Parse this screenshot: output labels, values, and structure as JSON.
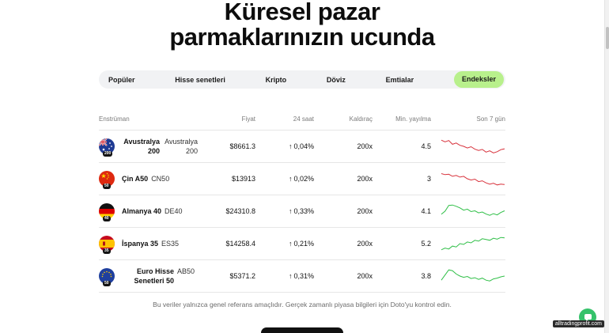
{
  "hero": {
    "line1": "Küresel pazar",
    "line2": "parmaklarınızın ucunda"
  },
  "tabs": [
    {
      "label": "Popüler",
      "active": false
    },
    {
      "label": "Hisse senetleri",
      "active": false
    },
    {
      "label": "Kripto",
      "active": false
    },
    {
      "label": "Döviz",
      "active": false
    },
    {
      "label": "Emtialar",
      "active": false
    },
    {
      "label": "Endeksler",
      "active": true
    }
  ],
  "table": {
    "headers": {
      "instrument": "Enstrüman",
      "price": "Fiyat",
      "change": "24 saat",
      "leverage": "Kaldıraç",
      "spread": "Min. yayılma",
      "chart": "Son 7 gün"
    },
    "rows": [
      {
        "name": "Avustralya 200",
        "ticker": "Avustralya 200",
        "badge": "200",
        "flag": "australia-flag-icon",
        "price": "$8661.3",
        "change": "0,04%",
        "leverage": "200x",
        "spread": "4.5",
        "trend": "down",
        "spark": [
          0.8,
          0.72,
          0.78,
          0.6,
          0.66,
          0.55,
          0.5,
          0.42,
          0.48,
          0.36,
          0.3,
          0.35,
          0.22,
          0.28,
          0.18,
          0.24,
          0.34,
          0.38
        ]
      },
      {
        "name": "Çin A50",
        "ticker": "CN50",
        "badge": "50",
        "flag": "china-flag-icon",
        "price": "$13913",
        "change": "0,02%",
        "leverage": "200x",
        "spread": "3",
        "trend": "down",
        "spark": [
          0.75,
          0.7,
          0.72,
          0.62,
          0.66,
          0.58,
          0.62,
          0.5,
          0.44,
          0.48,
          0.36,
          0.4,
          0.3,
          0.24,
          0.28,
          0.2,
          0.24,
          0.22
        ]
      },
      {
        "name": "Almanya 40",
        "ticker": "DE40",
        "badge": "40",
        "flag": "germany-flag-icon",
        "price": "$24310.8",
        "change": "0,33%",
        "leverage": "200x",
        "spread": "4.1",
        "trend": "up",
        "spark": [
          0.35,
          0.5,
          0.78,
          0.8,
          0.74,
          0.66,
          0.55,
          0.6,
          0.48,
          0.52,
          0.42,
          0.46,
          0.36,
          0.3,
          0.38,
          0.32,
          0.44,
          0.52
        ]
      },
      {
        "name": "İspanya 35",
        "ticker": "ES35",
        "badge": "35",
        "flag": "spain-flag-icon",
        "price": "$14258.4",
        "change": "0,21%",
        "leverage": "200x",
        "spread": "5.2",
        "trend": "up",
        "spark": [
          0.2,
          0.28,
          0.24,
          0.38,
          0.34,
          0.5,
          0.46,
          0.58,
          0.54,
          0.66,
          0.62,
          0.74,
          0.7,
          0.66,
          0.76,
          0.72,
          0.8,
          0.78
        ]
      },
      {
        "name": "Euro Hisse Senetleri 50",
        "ticker": "AB50",
        "badge": "50",
        "flag": "eu-flag-icon",
        "price": "$5371.2",
        "change": "0,31%",
        "leverage": "200x",
        "spread": "3.8",
        "trend": "up",
        "spark": [
          0.3,
          0.55,
          0.8,
          0.76,
          0.6,
          0.5,
          0.44,
          0.48,
          0.38,
          0.42,
          0.34,
          0.4,
          0.3,
          0.26,
          0.36,
          0.4,
          0.46,
          0.5
        ]
      }
    ]
  },
  "disclaimer": "Bu veriler yalnızca genel referans amaçlıdır. Gerçek zamanlı piyasa bilgileri için Doto'yu kontrol edin.",
  "watermark": "alltradingprofit.com",
  "colors": {
    "up": "#2fbf47",
    "down": "#d8323c",
    "active_tab": "#b8f08c",
    "chat": "#35c26a"
  }
}
